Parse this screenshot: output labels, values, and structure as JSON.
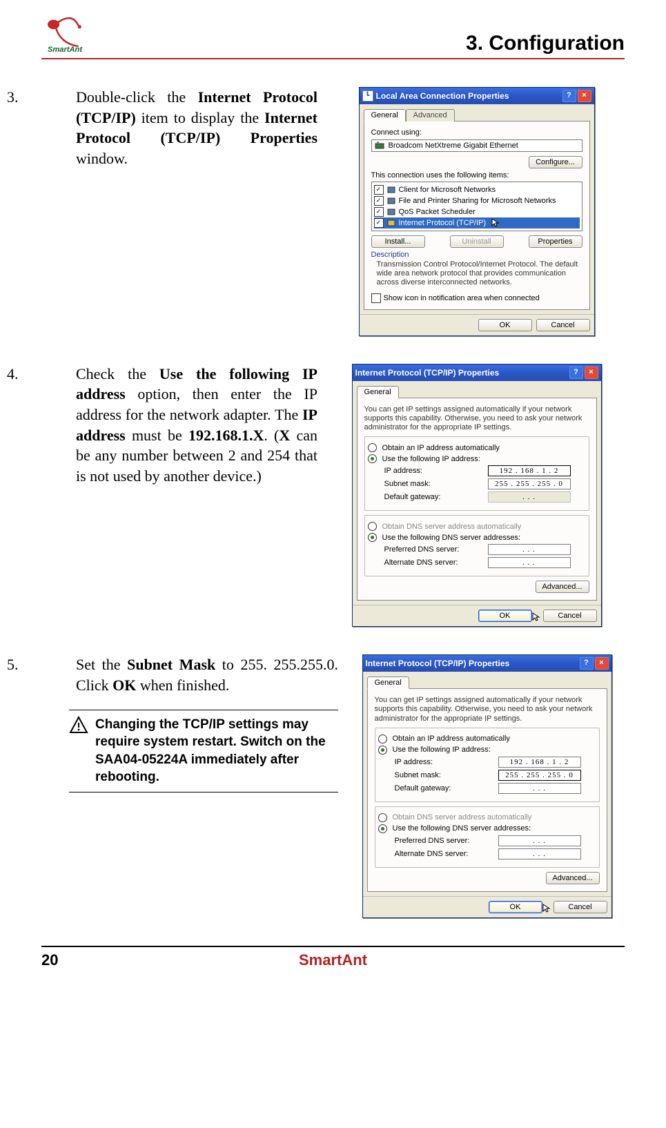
{
  "header": {
    "logo_text": "SmartAnt",
    "chapter": "3. Configuration"
  },
  "steps": {
    "s3": {
      "num": "3.",
      "t1": "Double-click the ",
      "b1": "Internet Protocol (TCP/IP)",
      "t2": " item to display the ",
      "b2": "Internet Protocol (TCP/IP) Properties",
      "t3": " window."
    },
    "s4": {
      "num": "4.",
      "t1": "Check the ",
      "b1": "Use the following IP address",
      "t2": " option, then enter the IP address for the network adapter. The ",
      "b2": "IP address",
      "t3": " must be ",
      "b3": "192.168.1.X",
      "t4": ". (",
      "b4": "X",
      "t5": " can be any number between 2 and 254 that is not used by another device.)"
    },
    "s5": {
      "num": "5.",
      "t1": "Set the ",
      "b1": "Subnet Mask",
      "t2": " to 255. 255.255.0. Click ",
      "b2": "OK",
      "t3": " when finished."
    }
  },
  "note": "Changing the TCP/IP settings may require system restart. Switch on the SAA04-05224A immediately after rebooting.",
  "footer": {
    "page": "20",
    "brand": "SmartAnt"
  },
  "dlg1": {
    "title": "Local Area Connection Properties",
    "help": "?",
    "close": "×",
    "tab_general": "General",
    "tab_adv": "Advanced",
    "connect_using": "Connect using:",
    "adapter": "Broadcom NetXtreme Gigabit Ethernet",
    "configure": "Configure...",
    "uses_items": "This connection uses the following items:",
    "item1": "Client for Microsoft Networks",
    "item2": "File and Printer Sharing for Microsoft Networks",
    "item3": "QoS Packet Scheduler",
    "item4": "Internet Protocol (TCP/IP)",
    "install": "Install...",
    "uninstall": "Uninstall",
    "properties": "Properties",
    "desc_title": "Description",
    "desc_body": "Transmission Control Protocol/Internet Protocol. The default wide area network protocol that provides communication across diverse interconnected networks.",
    "show_icon": "Show icon in notification area when connected",
    "ok": "OK",
    "cancel": "Cancel"
  },
  "dlg2": {
    "title": "Internet Protocol (TCP/IP) Properties",
    "help": "?",
    "close": "×",
    "tab_general": "General",
    "intro": "You can get IP settings assigned automatically if your network supports this capability. Otherwise, you need to ask your network administrator for the appropriate IP settings.",
    "r_auto": "Obtain an IP address automatically",
    "r_manual": "Use the following IP address:",
    "ip_label": "IP address:",
    "ip_value": "192 . 168  .   1   .   2",
    "mask_label": "Subnet mask:",
    "mask_value": "255 . 255 . 255 .   0",
    "gw_label": "Default gateway:",
    "gw_value": " .       .       . ",
    "r_dns_auto": "Obtain DNS server address automatically",
    "r_dns_manual": "Use the following DNS server addresses:",
    "dns1_label": "Preferred DNS server:",
    "dns1_value": " .       .       . ",
    "dns2_label": "Alternate DNS server:",
    "dns2_value": " .       .       . ",
    "advanced": "Advanced...",
    "ok": "OK",
    "cancel": "Cancel"
  }
}
